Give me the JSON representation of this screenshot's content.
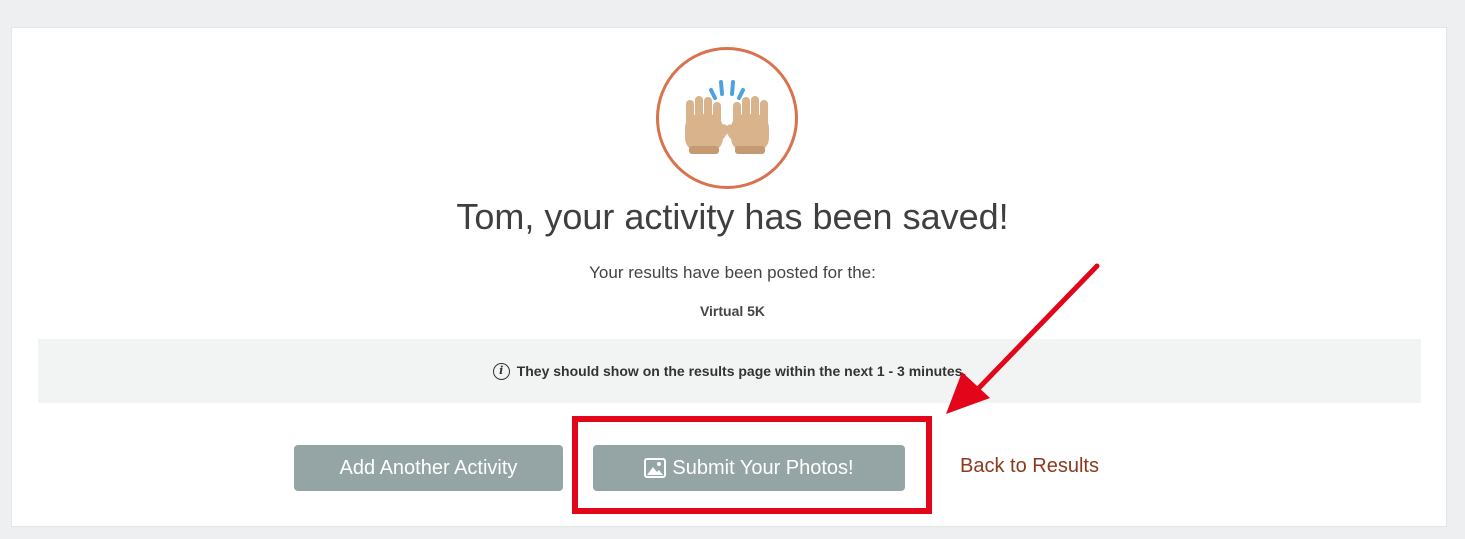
{
  "confirmation": {
    "title": "Tom, your activity has been saved!",
    "subtitle": "Your results have been posted for the:",
    "event_name": "Virtual 5K",
    "notice": "They should show on the results page within the next 1 - 3 minutes.",
    "notice_icon": "info-icon",
    "hero_icon": "raising-hands-icon"
  },
  "actions": {
    "add_activity_label": "Add Another Activity",
    "submit_photos_label": "Submit Your Photos!",
    "submit_photos_icon": "image-icon",
    "back_label": "Back to Results"
  },
  "colors": {
    "button_bg": "#95a5a6",
    "link": "#8b3a1e",
    "hero_ring": "#d9724f",
    "annotation_red": "#e3061b"
  }
}
